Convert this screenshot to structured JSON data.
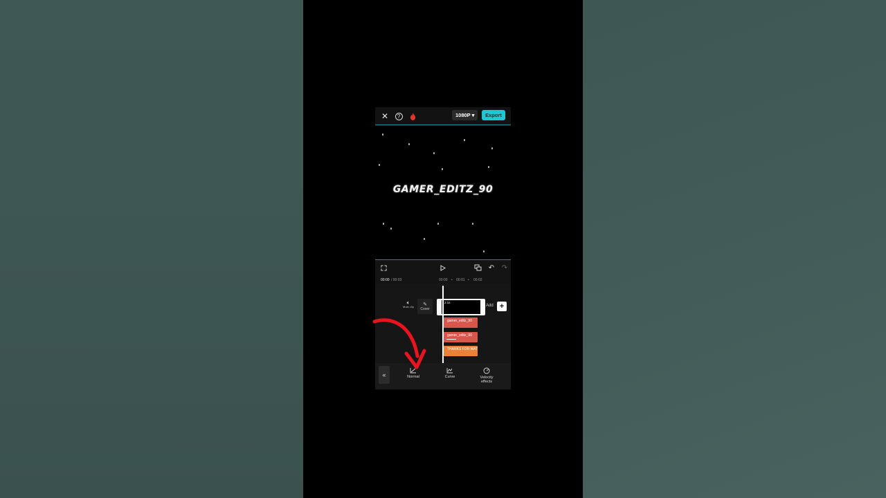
{
  "top_bar": {
    "resolution": "1080P ▾",
    "export_label": "Export"
  },
  "preview": {
    "overlay_text": "GAMER_EDITZ_90"
  },
  "ruler": {
    "current_time": "00:00",
    "total_time": "/ 00:03",
    "marks": [
      "00:00",
      "00:01",
      "00:02"
    ]
  },
  "timeline": {
    "mute_label": "Mute clip",
    "cover_label": "Cover",
    "main_clip_duration": "2.1s",
    "add_label": "Add",
    "text_clips": [
      "gamer_editz_90",
      "gamer_editz_90",
      "THANKS FOR WAT"
    ]
  },
  "toolbar": {
    "tools": [
      {
        "label": "Normal",
        "icon": "normal-speed-icon"
      },
      {
        "label": "Curve",
        "icon": "curve-speed-icon"
      },
      {
        "label": "Velocity effects",
        "icon": "velocity-effects-icon"
      }
    ]
  },
  "colors": {
    "accent": "#1ec8d2",
    "text_clip_red": "#d9574a",
    "text_clip_orange": "#e8823a",
    "annotation_red": "#e8141e"
  }
}
